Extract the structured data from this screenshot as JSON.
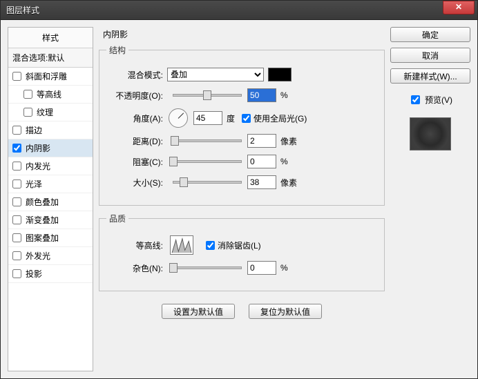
{
  "window": {
    "title": "图层样式"
  },
  "close_glyph": "✕",
  "styles_panel": {
    "header": "样式",
    "blend_options": "混合选项:默认",
    "items": [
      {
        "label": "斜面和浮雕",
        "checked": false,
        "indent": false
      },
      {
        "label": "等高线",
        "checked": false,
        "indent": true
      },
      {
        "label": "纹理",
        "checked": false,
        "indent": true
      },
      {
        "label": "描边",
        "checked": false,
        "indent": false
      },
      {
        "label": "内阴影",
        "checked": true,
        "indent": false,
        "selected": true
      },
      {
        "label": "内发光",
        "checked": false,
        "indent": false
      },
      {
        "label": "光泽",
        "checked": false,
        "indent": false
      },
      {
        "label": "颜色叠加",
        "checked": false,
        "indent": false
      },
      {
        "label": "渐变叠加",
        "checked": false,
        "indent": false
      },
      {
        "label": "图案叠加",
        "checked": false,
        "indent": false
      },
      {
        "label": "外发光",
        "checked": false,
        "indent": false
      },
      {
        "label": "投影",
        "checked": false,
        "indent": false
      }
    ]
  },
  "center": {
    "title": "内阴影",
    "structure": {
      "legend": "结构",
      "blend_mode_label": "混合模式:",
      "blend_mode_value": "叠加",
      "opacity_label": "不透明度(O):",
      "opacity_value": "50",
      "opacity_unit": "%",
      "angle_label": "角度(A):",
      "angle_value": "45",
      "angle_unit": "度",
      "global_light_label": "使用全局光(G)",
      "global_light_checked": true,
      "distance_label": "距离(D):",
      "distance_value": "2",
      "distance_unit": "像素",
      "choke_label": "阻塞(C):",
      "choke_value": "0",
      "choke_unit": "%",
      "size_label": "大小(S):",
      "size_value": "38",
      "size_unit": "像素"
    },
    "quality": {
      "legend": "品质",
      "contour_label": "等高线:",
      "antialias_label": "消除锯齿(L)",
      "antialias_checked": true,
      "noise_label": "杂色(N):",
      "noise_value": "0",
      "noise_unit": "%"
    },
    "buttons": {
      "make_default": "设置为默认值",
      "reset_default": "复位为默认值"
    }
  },
  "right": {
    "ok": "确定",
    "cancel": "取消",
    "new_style": "新建样式(W)...",
    "preview_label": "预览(V)",
    "preview_checked": true
  }
}
